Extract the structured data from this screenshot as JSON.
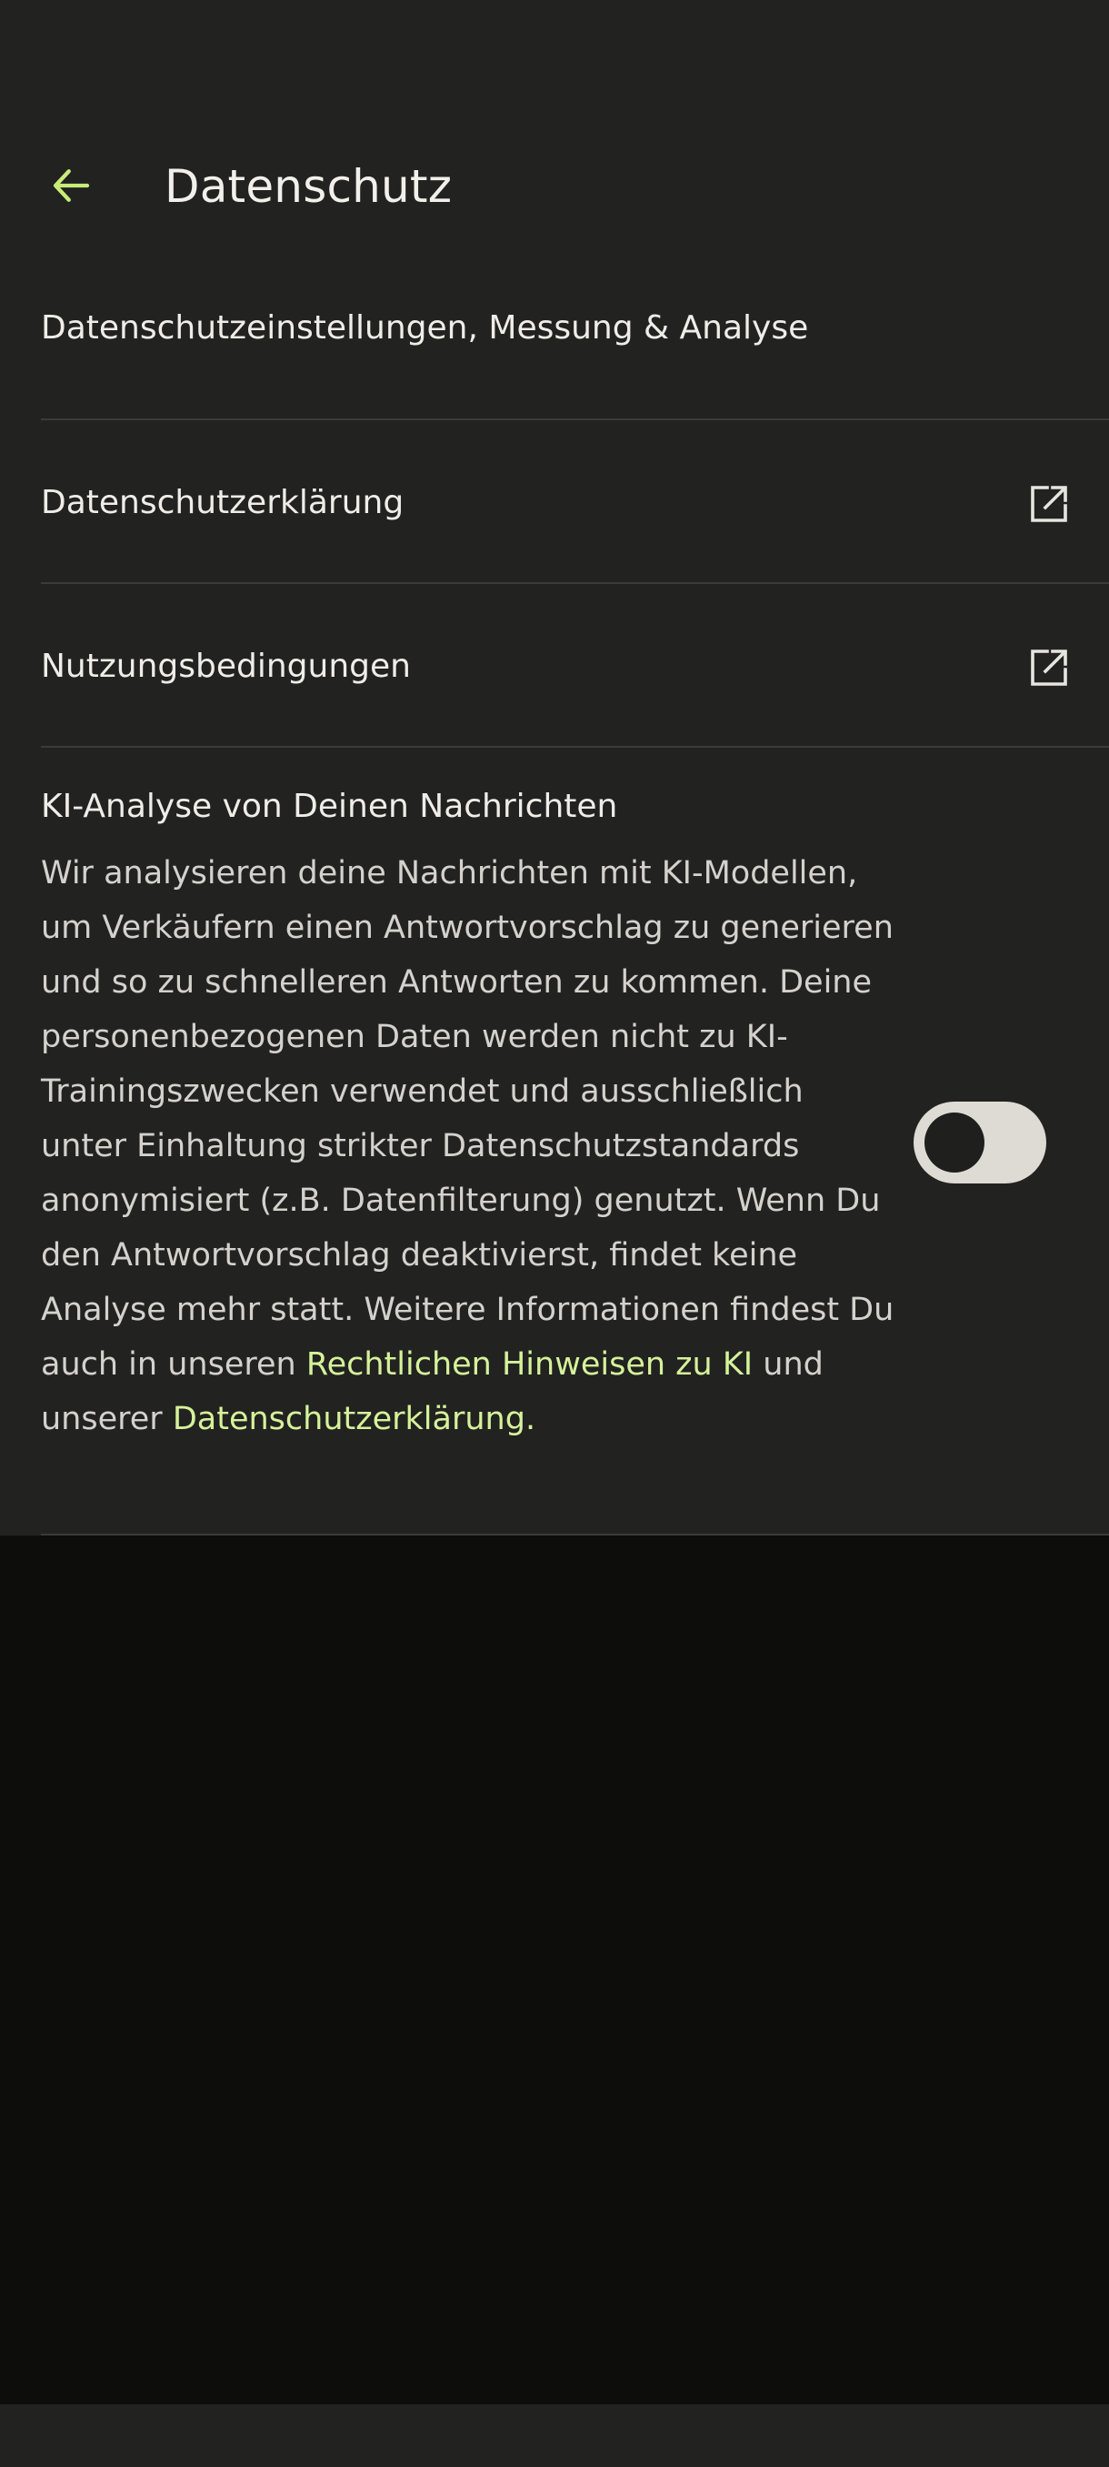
{
  "app_bar": {
    "title": "Datenschutz",
    "back_icon": "arrow-left-icon",
    "accent_color": "#c8ec7a"
  },
  "rows": [
    {
      "label": "Datenschutzeinstellungen, Messung & Analyse"
    },
    {
      "label": "Datenschutzerklärung",
      "icon": "external-link-icon"
    },
    {
      "label": "Nutzungsbedingungen",
      "icon": "external-link-icon"
    }
  ],
  "ai_section": {
    "title": "KI-Analyse von Deinen Nachrichten",
    "description_text": "Wir analysieren deine Nachrichten mit KI-Modellen, um Verkäufern einen Antwortvorschlag zu generieren und so zu schnelleren Antworten zu kommen. Deine personenbezogenen Daten werden nicht zu KI-Trainingszwecken verwendet und ausschließlich unter Einhaltung strikter Datenschutzstandards anonymisiert (z.B. Datenfilterung) genutzt. Wenn Du den Antwortvorschlag deaktivierst, findet keine Analyse mehr statt. Weitere Informationen findest Du auch in unseren",
    "link_1": "Rechtlichen Hinweisen zu KI",
    "middle_text": "und unserer",
    "link_2": "Datenschutzerklärung",
    "end_text": ".",
    "toggle_state": "off",
    "link_color": "#d6f29a"
  }
}
